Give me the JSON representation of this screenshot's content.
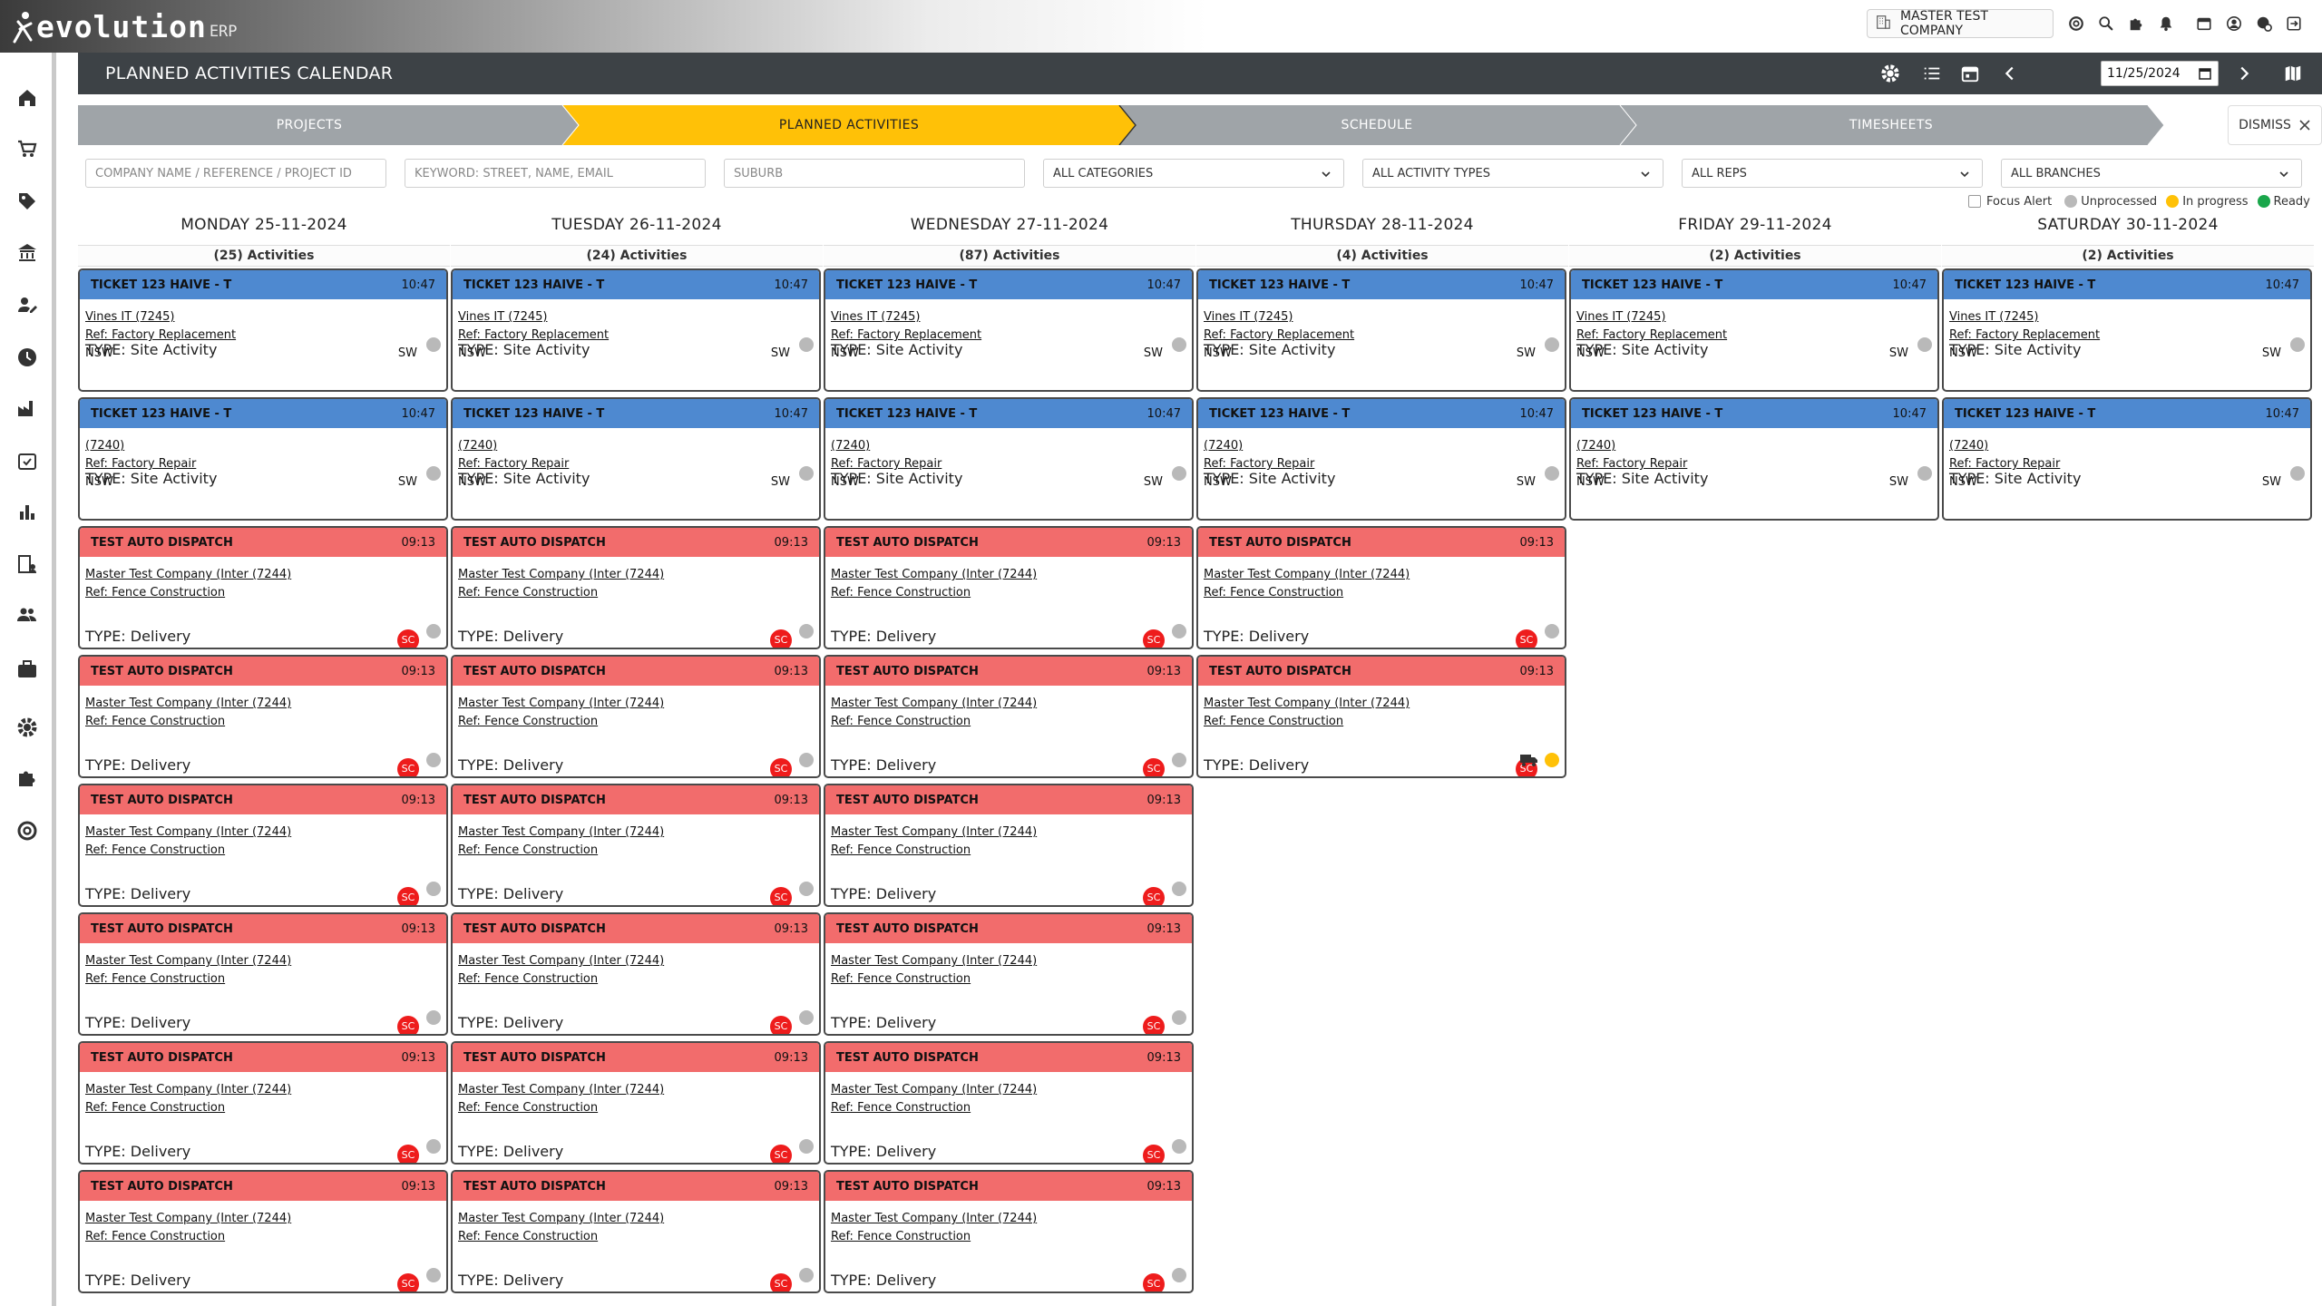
{
  "app": {
    "brand_word": "evolution",
    "brand_suffix": "ERP",
    "company_name": "MASTER TEST COMPANY"
  },
  "page": {
    "title": "PLANNED ACTIVITIES CALENDAR",
    "date_value": "11/25/2024"
  },
  "steps": [
    {
      "label": "PROJECTS",
      "active": false
    },
    {
      "label": "PLANNED ACTIVITIES",
      "active": true
    },
    {
      "label": "SCHEDULE",
      "active": false
    },
    {
      "label": "TIMESHEETS",
      "active": false
    }
  ],
  "dismiss_label": "DISMISS",
  "filters": {
    "company_placeholder": "COMPANY NAME / REFERENCE / PROJECT ID",
    "keyword_placeholder": "KEYWORD: STREET, NAME, EMAIL",
    "suburb_placeholder": "SUBURB",
    "categories": "ALL CATEGORIES",
    "activity_types": "ALL ACTIVITY TYPES",
    "reps": "ALL REPS",
    "branches": "ALL BRANCHES"
  },
  "legend": {
    "focus_alert": "Focus Alert",
    "unprocessed": "Unprocessed",
    "in_progress": "In progress",
    "ready": "Ready",
    "colors": {
      "unprocessed": "#b9b9b9",
      "in_progress": "#ffc107",
      "ready": "#1aa64b"
    }
  },
  "colors": {
    "blue_header": "#4e89d0",
    "red_header": "#f26c6c",
    "sc_badge": "#ee1c1c",
    "step_active": "#ffc107"
  },
  "days": [
    {
      "title": "MONDAY 25-11-2024",
      "count": "(25) Activities"
    },
    {
      "title": "TUESDAY 26-11-2024",
      "count": "(24) Activities"
    },
    {
      "title": "WEDNESDAY 27-11-2024",
      "count": "(87) Activities"
    },
    {
      "title": "THURSDAY 28-11-2024",
      "count": "(4) Activities"
    },
    {
      "title": "FRIDAY 29-11-2024",
      "count": "(2) Activities"
    },
    {
      "title": "SATURDAY 30-11-2024",
      "count": "(2) Activities"
    }
  ],
  "cards": {
    "site1": {
      "header": "TICKET 123 HAIVE - T",
      "time": "10:47",
      "client": "Vines IT (7245)",
      "ref": "Ref: Factory Replacement",
      "state": "NSW",
      "region": "SW",
      "type": "TYPE: Site Activity"
    },
    "site2": {
      "header": "TICKET 123 HAIVE - T",
      "time": "10:47",
      "client": "(7240)",
      "ref": "Ref: Factory Repair",
      "state": "NSW",
      "region": "SW",
      "type": "TYPE: Site Activity"
    },
    "dispatch": {
      "header": "TEST AUTO DISPATCH",
      "time": "09:13",
      "client": "Master Test Company (Inter (7244)",
      "ref": "Ref: Fence Construction",
      "badge": "SC",
      "type": "TYPE: Delivery"
    }
  },
  "dispatch_counts_per_day": [
    6,
    6,
    6,
    2,
    0,
    0
  ]
}
